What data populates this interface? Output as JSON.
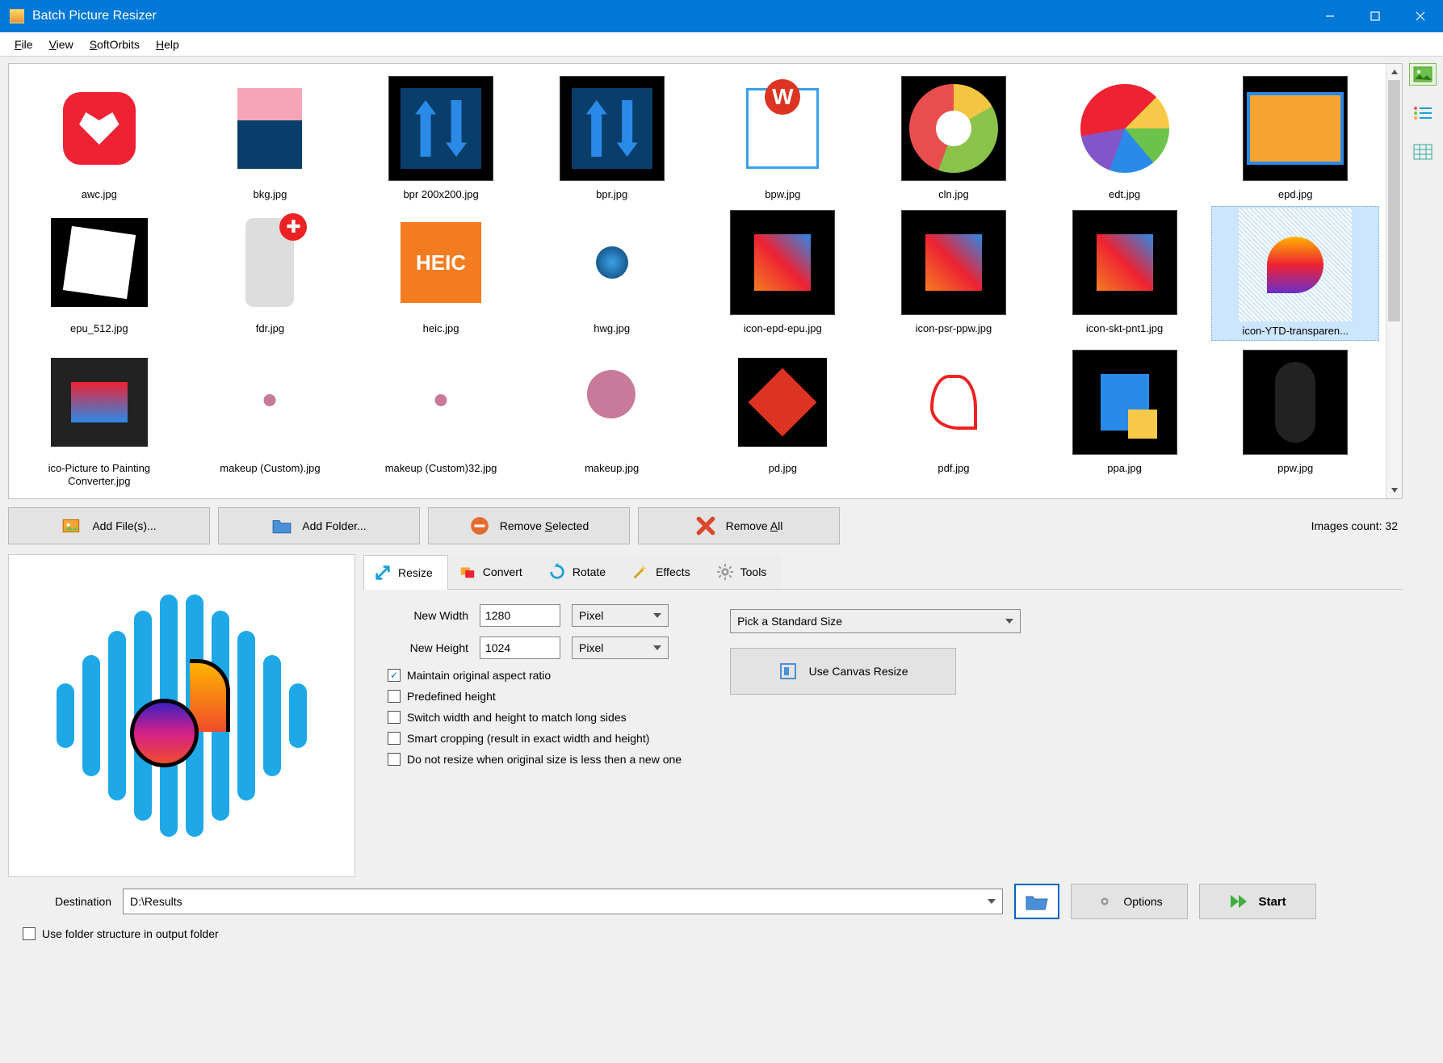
{
  "app": {
    "title": "Batch Picture Resizer"
  },
  "menu": {
    "file": "File",
    "file_u": "F",
    "view": "View",
    "view_u": "V",
    "softorbits": "SoftOrbits",
    "softorbits_u": "S",
    "help": "Help",
    "help_u": "H"
  },
  "thumbnails": [
    {
      "label": "awc.jpg"
    },
    {
      "label": "bkg.jpg"
    },
    {
      "label": "bpr 200x200.jpg"
    },
    {
      "label": "bpr.jpg"
    },
    {
      "label": "bpw.jpg"
    },
    {
      "label": "cln.jpg"
    },
    {
      "label": "edt.jpg"
    },
    {
      "label": "epd.jpg"
    },
    {
      "label": "epu_512.jpg"
    },
    {
      "label": "fdr.jpg"
    },
    {
      "label": "heic.jpg"
    },
    {
      "label": "hwg.jpg"
    },
    {
      "label": "icon-epd-epu.jpg"
    },
    {
      "label": "icon-psr-ppw.jpg"
    },
    {
      "label": "icon-skt-pnt1.jpg"
    },
    {
      "label": "icon-YTD-transparen...",
      "selected": true
    },
    {
      "label": "ico-Picture to Painting Converter.jpg"
    },
    {
      "label": "makeup (Custom).jpg"
    },
    {
      "label": "makeup (Custom)32.jpg"
    },
    {
      "label": "makeup.jpg"
    },
    {
      "label": "pd.jpg"
    },
    {
      "label": "pdf.jpg"
    },
    {
      "label": "ppa.jpg"
    },
    {
      "label": "ppw.jpg"
    }
  ],
  "toolbar": {
    "add_files": "Add File(s)...",
    "add_folder": "Add Folder...",
    "remove_selected_pre": "Remove ",
    "remove_selected_u": "S",
    "remove_selected_post": "elected",
    "remove_all_pre": "Remove ",
    "remove_all_u": "A",
    "remove_all_post": "ll",
    "images_count_label": "Images count: 32"
  },
  "tabs": {
    "resize": "Resize",
    "convert": "Convert",
    "rotate": "Rotate",
    "effects": "Effects",
    "tools": "Tools"
  },
  "resize": {
    "new_width_label": "New Width",
    "new_height_label": "New Height",
    "width_value": "1280",
    "height_value": "1024",
    "unit": "Pixel",
    "std_size_placeholder": "Pick a Standard Size",
    "canvas_btn": "Use Canvas Resize",
    "chk_aspect": "Maintain original aspect ratio",
    "chk_predef": "Predefined height",
    "chk_switch": "Switch width and height to match long sides",
    "chk_smart": "Smart cropping (result in exact width and height)",
    "chk_noresize": "Do not resize when original size is less then a new one"
  },
  "bottom": {
    "destination_label": "Destination",
    "destination_value": "D:\\Results",
    "options": "Options",
    "start": "Start",
    "use_folder_structure": "Use folder structure in output folder"
  }
}
